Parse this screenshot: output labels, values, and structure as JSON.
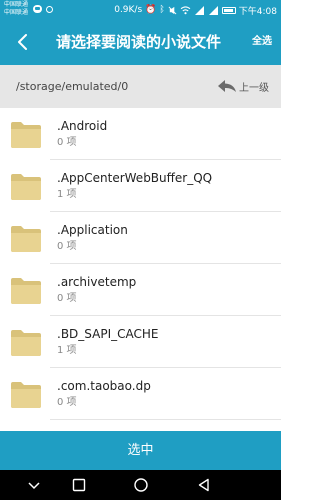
{
  "status_bar": {
    "carrier_line1": "中国联通",
    "carrier_line2": "中国联通",
    "speed": "0.9K/s",
    "battery": "37",
    "time": "下午4:08",
    "icons": [
      "chat-icon",
      "alarm-icon",
      "bluetooth-icon",
      "mute-icon",
      "wifi-icon",
      "signal-icon",
      "battery-icon"
    ]
  },
  "toolbar": {
    "title": "请选择要阅读的小说文件",
    "select_all": "全选",
    "accent_color": "#1f9ec3"
  },
  "path_bar": {
    "path": "/storage/emulated/0",
    "up_label": "上一级"
  },
  "files": [
    {
      "name": ".Android",
      "count": "0 项"
    },
    {
      "name": ".AppCenterWebBuffer_QQ",
      "count": "1 项"
    },
    {
      "name": ".Application",
      "count": "0 项"
    },
    {
      "name": ".archivetemp",
      "count": "0 项"
    },
    {
      "name": ".BD_SAPI_CACHE",
      "count": "1 项"
    },
    {
      "name": ".com.taobao.dp",
      "count": "0 项"
    }
  ],
  "confirm_button": {
    "label": "选中"
  },
  "nav_bar": {
    "icons": [
      "chevron-down-icon",
      "square-icon",
      "circle-icon",
      "triangle-back-icon"
    ]
  }
}
